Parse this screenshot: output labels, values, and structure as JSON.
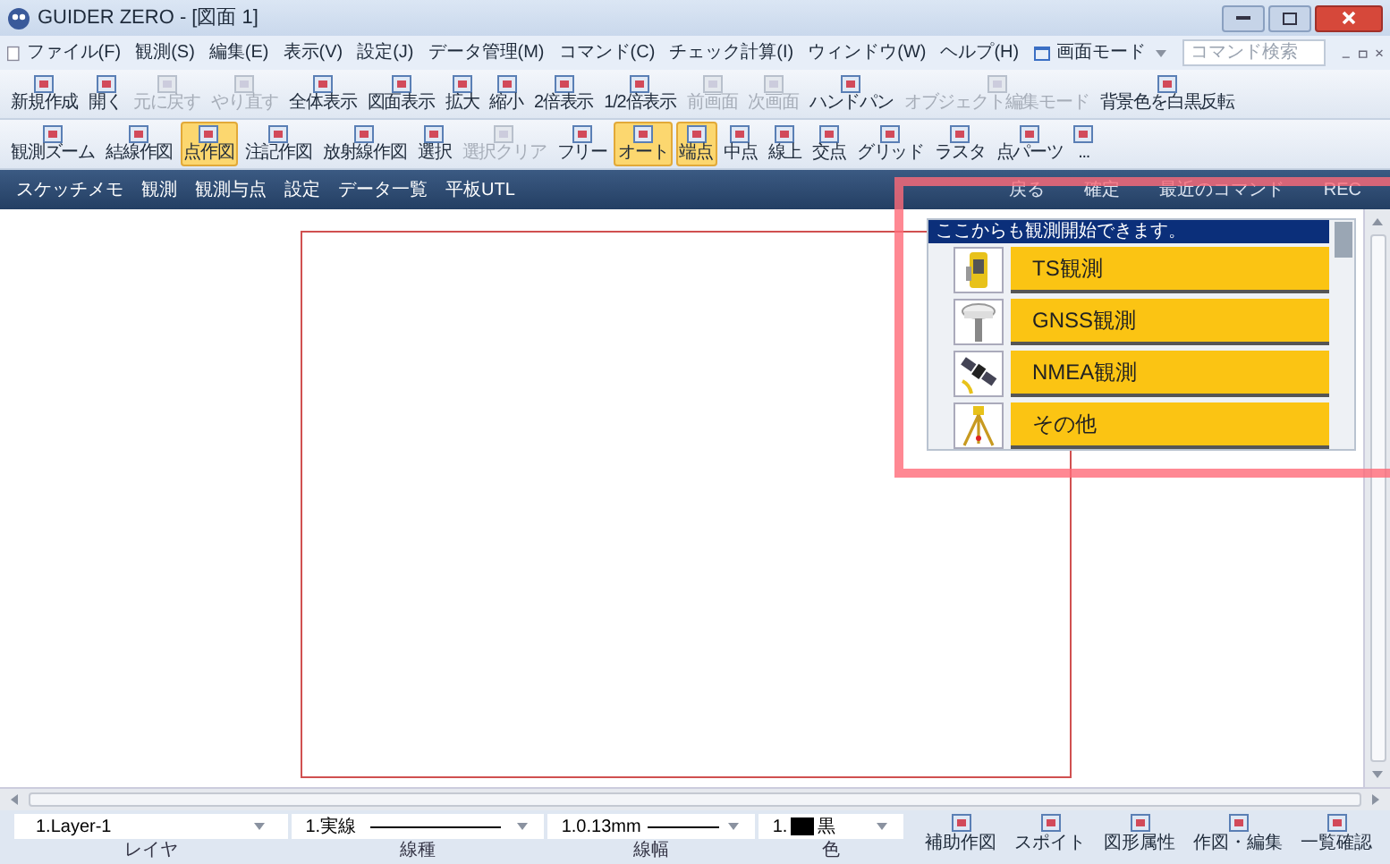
{
  "window": {
    "title": "GUIDER ZERO - [図面 1]"
  },
  "menu": [
    "ファイル(F)",
    "観測(S)",
    "編集(E)",
    "表示(V)",
    "設定(J)",
    "データ管理(M)",
    "コマンド(C)",
    "チェック計算(I)",
    "ウィンドウ(W)",
    "ヘルプ(H)"
  ],
  "screen_mode": "画面モード",
  "command_search": {
    "placeholder": "コマンド検索"
  },
  "toolbar_rows": [
    [
      {
        "label": "新規作成",
        "disabled": false,
        "selected": false
      },
      {
        "label": "開く",
        "disabled": false,
        "selected": false
      },
      {
        "label": "元に戻す",
        "disabled": true,
        "selected": false
      },
      {
        "label": "やり直す",
        "disabled": true,
        "selected": false
      },
      {
        "label": "全体表示",
        "disabled": false,
        "selected": false
      },
      {
        "label": "図面表示",
        "disabled": false,
        "selected": false
      },
      {
        "label": "拡大",
        "disabled": false,
        "selected": false
      },
      {
        "label": "縮小",
        "disabled": false,
        "selected": false
      },
      {
        "label": "2倍表示",
        "disabled": false,
        "selected": false
      },
      {
        "label": "1/2倍表示",
        "disabled": false,
        "selected": false
      },
      {
        "label": "前画面",
        "disabled": true,
        "selected": false
      },
      {
        "label": "次画面",
        "disabled": true,
        "selected": false
      },
      {
        "label": "ハンドパン",
        "disabled": false,
        "selected": false
      },
      {
        "label": "オブジェクト編集モード",
        "disabled": true,
        "selected": false
      },
      {
        "label": "背景色を白黒反転",
        "disabled": false,
        "selected": false
      }
    ],
    [
      {
        "label": "観測ズーム",
        "disabled": false,
        "selected": false
      },
      {
        "label": "結線作図",
        "disabled": false,
        "selected": false
      },
      {
        "label": "点作図",
        "disabled": false,
        "selected": true
      },
      {
        "label": "注記作図",
        "disabled": false,
        "selected": false
      },
      {
        "label": "放射線作図",
        "disabled": false,
        "selected": false
      },
      {
        "label": "選択",
        "disabled": false,
        "selected": false
      },
      {
        "label": "選択クリア",
        "disabled": true,
        "selected": false
      },
      {
        "label": "フリー",
        "disabled": false,
        "selected": false
      },
      {
        "label": "オート",
        "disabled": false,
        "selected": true
      },
      {
        "label": "端点",
        "disabled": false,
        "selected": true
      },
      {
        "label": "中点",
        "disabled": false,
        "selected": false
      },
      {
        "label": "線上",
        "disabled": false,
        "selected": false
      },
      {
        "label": "交点",
        "disabled": false,
        "selected": false
      },
      {
        "label": "グリッド",
        "disabled": false,
        "selected": false
      },
      {
        "label": "ラスタ",
        "disabled": false,
        "selected": false
      },
      {
        "label": "点パーツ",
        "disabled": false,
        "selected": false
      },
      {
        "label": "...",
        "disabled": false,
        "selected": false
      }
    ]
  ],
  "nav_left": [
    "スケッチメモ",
    "観測",
    "観測与点",
    "設定",
    "データ一覧",
    "平板UTL"
  ],
  "nav_right": [
    "戻る",
    "確定",
    "最近のコマンド",
    "REC"
  ],
  "panel": {
    "header": "ここからも観測開始できます。",
    "items": [
      {
        "kind": "total-station",
        "label": "TS観測"
      },
      {
        "kind": "gnss",
        "label": "GNSS観測"
      },
      {
        "kind": "satellite",
        "label": "NMEA観測"
      },
      {
        "kind": "tripod",
        "label": "その他"
      }
    ]
  },
  "bottom": {
    "layer": {
      "value": "1.Layer-1",
      "label": "レイヤ"
    },
    "line_type": {
      "value": "1.実線",
      "label": "線種"
    },
    "line_width": {
      "value": "1.0.13mm",
      "label": "線幅"
    },
    "color": {
      "value_prefix": "1.",
      "value": "黒",
      "color": "#000000",
      "label": "色"
    },
    "buttons": [
      "補助作図",
      "スポイト",
      "図形属性",
      "作図・編集",
      "一覧確認"
    ]
  }
}
